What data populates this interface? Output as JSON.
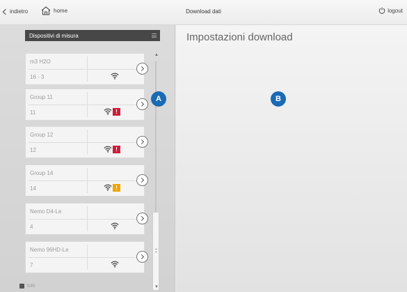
{
  "topbar": {
    "back_label": "indietro",
    "home_label": "home",
    "title": "Download dati",
    "logout_label": "logout"
  },
  "panel": {
    "header": "Dispositivi di misura",
    "devices": [
      {
        "name": "m3 H2O",
        "id": "16 - 3",
        "badge": null
      },
      {
        "name": "Group 11",
        "id": "11",
        "badge": {
          "text": "!",
          "color": "#cc1e3a"
        }
      },
      {
        "name": "Group 12",
        "id": "12",
        "badge": {
          "text": "!",
          "color": "#cc1e3a"
        }
      },
      {
        "name": "Group 14",
        "id": "14",
        "badge": {
          "text": "!",
          "color": "#f0a500"
        }
      },
      {
        "name": "Nemo D4-Le",
        "id": "4",
        "badge": null
      },
      {
        "name": "Nemo 96HD-Le",
        "id": "7",
        "badge": null
      }
    ],
    "legend_label": "tutti"
  },
  "main": {
    "title": "Impostazioni download"
  },
  "markers": {
    "a": "A",
    "b": "B",
    "color": "#1a6ab5"
  }
}
